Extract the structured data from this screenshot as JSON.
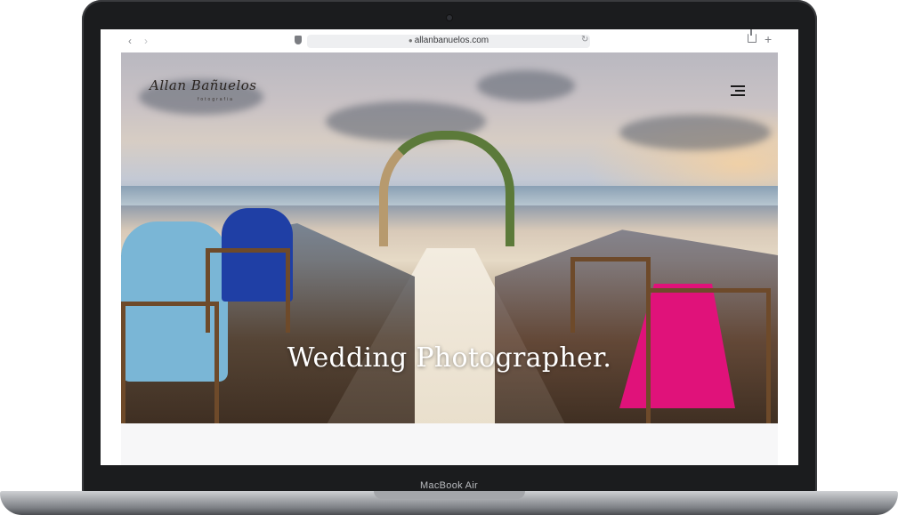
{
  "browser": {
    "back": "‹",
    "forward": "›",
    "url": "allanbanuelos.com",
    "reload": "↻",
    "plus": "+"
  },
  "website": {
    "logo": "Allan Bañuelos",
    "logo_sub": "fotografia",
    "hero_title": "Wedding Photographer."
  },
  "device": {
    "label": "MacBook Air"
  },
  "icons": [
    "back-arrow-icon",
    "forward-arrow-icon",
    "shield-icon",
    "lock-icon",
    "reload-icon",
    "share-icon",
    "plus-icon",
    "hamburger-menu-icon"
  ]
}
